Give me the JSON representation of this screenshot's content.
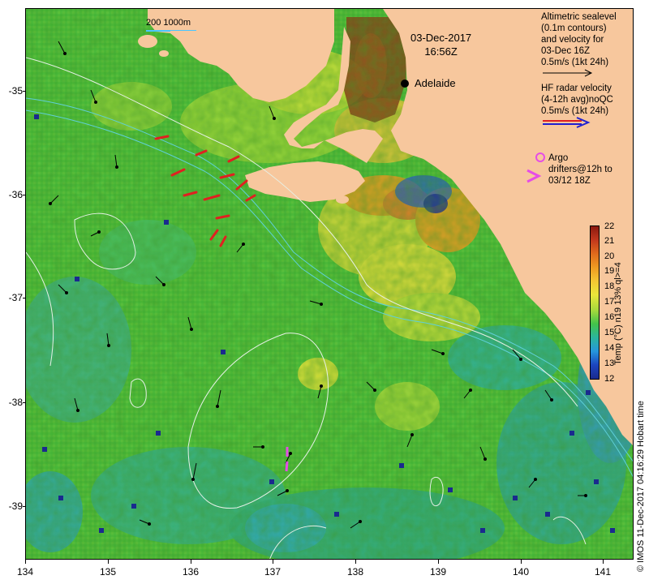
{
  "map": {
    "date_line1": "03-Dec-2017",
    "date_line2": "16:56Z",
    "city": "Adelaide",
    "scale_text": "200  1000m"
  },
  "axes": {
    "lon_labels": [
      "134",
      "135",
      "136",
      "137",
      "138",
      "139",
      "140",
      "141"
    ],
    "lat_labels": [
      "-35",
      "-36",
      "-37",
      "-38",
      "-39"
    ]
  },
  "legend": {
    "altimetry": {
      "lines": [
        "Altimetric sealevel",
        "(0.1m contours)",
        "and velocity for",
        "03-Dec 16Z",
        "0.5m/s (1kt 24h)"
      ]
    },
    "hf_radar": {
      "lines": [
        "HF radar velocity",
        "(4-12h avg)noQC",
        "0.5m/s (1kt 24h)"
      ]
    },
    "argo": {
      "lines": [
        "Argo",
        "drifters@12h to",
        "03/12 18Z"
      ]
    }
  },
  "colorbar": {
    "title": "Temp (°C) n19 13% ql>=4",
    "ticks": [
      "22",
      "21",
      "20",
      "19",
      "18",
      "17",
      "16",
      "15",
      "14",
      "13",
      "12"
    ],
    "colors": [
      "#8b1a10",
      "#c2371d",
      "#e06a1c",
      "#ee9b22",
      "#f4c733",
      "#e9e73a",
      "#a7d93c",
      "#43c34a",
      "#2bb59d",
      "#2696dc",
      "#1c45bf",
      "#1a2a8e"
    ]
  },
  "colors": {
    "land": "#f7c79d",
    "ocean_base": "#52c13a",
    "contour": "#e6f0e6",
    "bathy": "#5fd0d8",
    "argo": "#e64de6",
    "hf_red": "#e02020",
    "hf_blue": "#2020d0"
  },
  "credit": "© IMOS 11-Dec-2017 04:16:29 Hobart time"
}
